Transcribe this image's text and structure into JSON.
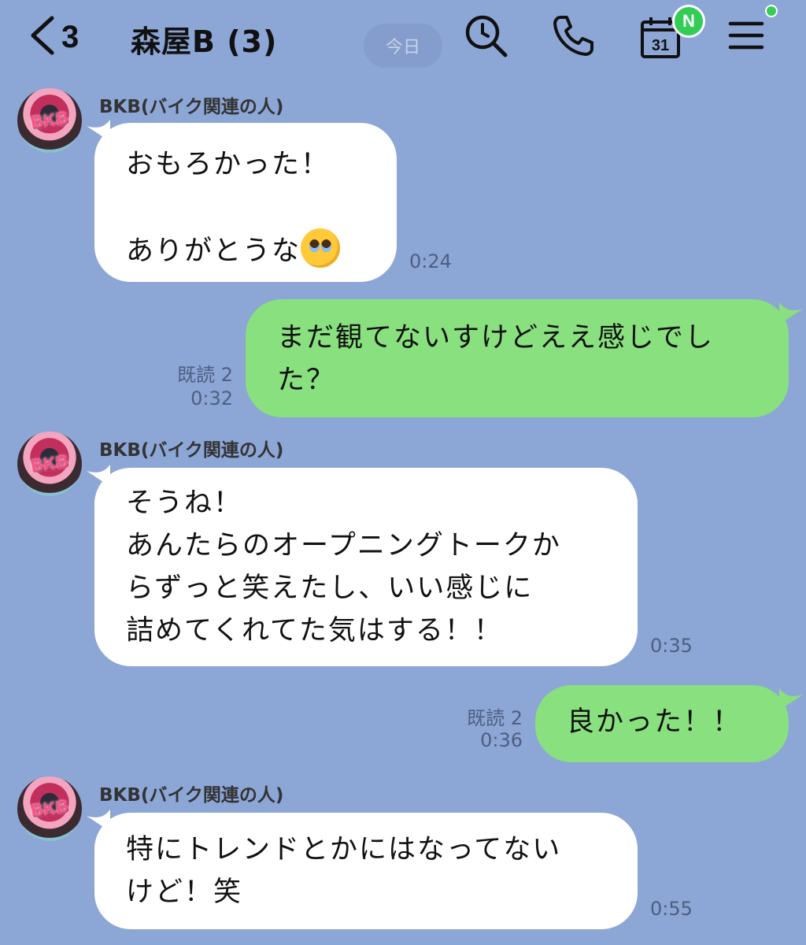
{
  "header": {
    "unread_count": "3",
    "title": "森屋B (3)",
    "date_pill": "今日",
    "calendar_day": "31",
    "badge": "N"
  },
  "messages": [
    {
      "direction": "in",
      "sender": "BKB(バイク関連の人)",
      "text": "おもろかった！\n\nありがとうな",
      "emoji": "pleading-face",
      "time": "0:24"
    },
    {
      "direction": "out",
      "text": "まだ観てないすけどええ感じでし\nた？",
      "read": "既読 2",
      "time": "0:32"
    },
    {
      "direction": "in",
      "sender": "BKB(バイク関連の人)",
      "text": "そうね！\nあんたらのオープニングトークか\nらずっと笑えたし、いい感じに\n詰めてくれてた気はする！！",
      "time": "0:35"
    },
    {
      "direction": "out",
      "text": "良かった！！",
      "read": "既読 2",
      "time": "0:36"
    },
    {
      "direction": "in",
      "sender": "BKB(バイク関連の人)",
      "text": "特にトレンドとかにはなってない\nけど！笑",
      "time": "0:55"
    }
  ],
  "colors": {
    "background": "#8ca6d6",
    "incoming_bubble": "#ffffff",
    "outgoing_bubble": "#89e07e",
    "badge_green": "#33cc55"
  }
}
